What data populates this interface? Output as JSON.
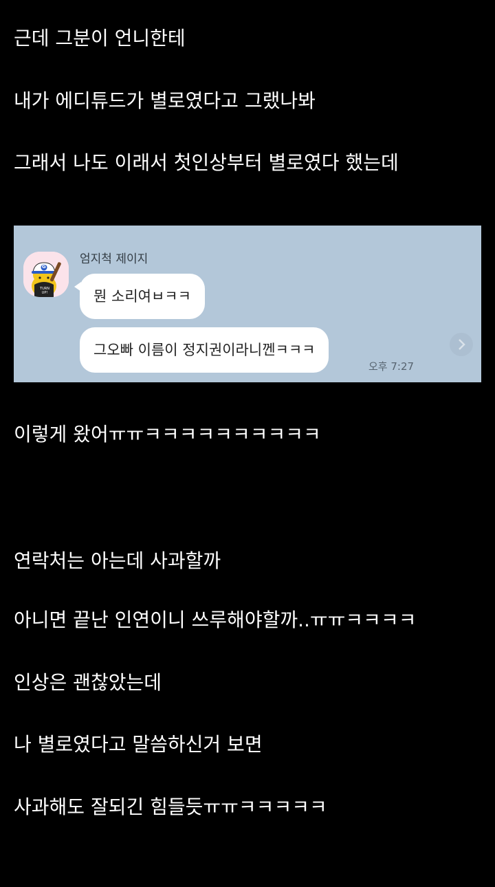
{
  "post_lines_top": [
    "근데 그분이 언니한테",
    "내가 에디튜드가 별로였다고 그랬나봐",
    "그래서 나도 이래서 첫인상부터 별로였다 했는데"
  ],
  "chat": {
    "sender_name": "엄지척 제이지",
    "messages": [
      "뭔 소리여ㅂㅋㅋ",
      "그오빠 이름이 정지권이라니껜ㅋㅋㅋ"
    ],
    "time": "오후 7:27",
    "avatar_cap_letter": "G",
    "avatar_shirt_text": "TURN UP!",
    "colors": {
      "background": "#b3c7d9",
      "bubble": "#ffffff",
      "avatar_bg": "#fbe3ea"
    }
  },
  "post_lines_bottom": [
    "이렇게 왔어ㅠㅠㅋㅋㅋㅋㅋㅋㅋㅋㅋㅋ",
    "연락처는 아는데 사과할까",
    "아니면 끝난 인연이니 쓰루해야할까..ㅠㅠㅋㅋㅋㅋ",
    "인상은 괜찮았는데",
    "나 별로였다고 말씀하신거 보면",
    "사과해도 잘되긴 힘들듯ㅠㅠㅋㅋㅋㅋㅋ"
  ],
  "page_background": "#000000"
}
